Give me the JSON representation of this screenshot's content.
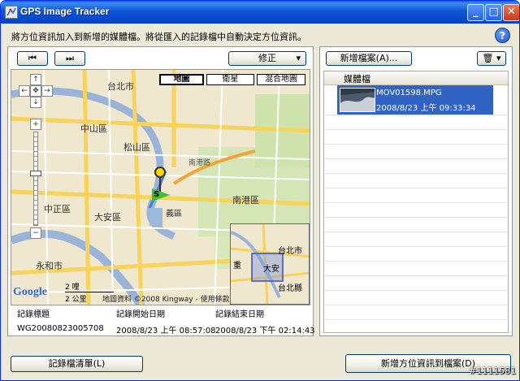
{
  "window": {
    "title": "GPS Image Tracker",
    "min_label": "_",
    "max_label": "□",
    "close_label": "✕"
  },
  "instruction": "將方位資訊加入到新增的媒體檔。將從匯入的記錄檔中自動決定方位資訊。",
  "help_label": "?",
  "toolbar": {
    "prev_label": "⏮",
    "next_label": "⏭",
    "correct_label": "修正",
    "add_file_label": "新增檔案(A)...",
    "delete_label": "🗑"
  },
  "map": {
    "types": [
      "地圖",
      "衛星",
      "混合地圖"
    ],
    "active_type": "地圖",
    "nav": {
      "up": "↑",
      "down": "↓",
      "left": "←",
      "right": "→",
      "center": "✥",
      "zoom_in": "+",
      "zoom_out": "−"
    },
    "labels": {
      "taipei_city": "台北市",
      "zhongshan": "中山區",
      "songshan": "松山區",
      "nangang": "南港區",
      "zhongzheng": "中正區",
      "daan": "大安區",
      "xinyi": "義區",
      "yonghe": "永和市",
      "taipei_county": "台北縣",
      "nangang_road": "南港路",
      "google": "Google",
      "scale_top": "2 哩",
      "scale_bottom": "2 公里",
      "copyright": "地圖資料 ©2008 Kingway - 使用條款",
      "start_marker": "S"
    },
    "overview_labels": {
      "a": "台北市",
      "b": "大安",
      "c": "台北縣",
      "d": "重"
    }
  },
  "log_info": {
    "headers": [
      "記錄標題",
      "記錄開始日期",
      "記錄結束日期"
    ],
    "values": [
      "WG20080823005708",
      "2008/8/23 上午 08:57:08",
      "2008/8/23 下午 02:14:43"
    ]
  },
  "media_list": {
    "header": "媒體檔",
    "items": [
      {
        "filename": "MOV01598.MPG",
        "date": "2008/8/23 上午 09:33:34",
        "selected": true
      }
    ]
  },
  "footer": {
    "log_list_label": "記錄檔清單(L)",
    "save_label": "新增方位資訊到檔案(D)"
  },
  "watermark": "#1111581"
}
